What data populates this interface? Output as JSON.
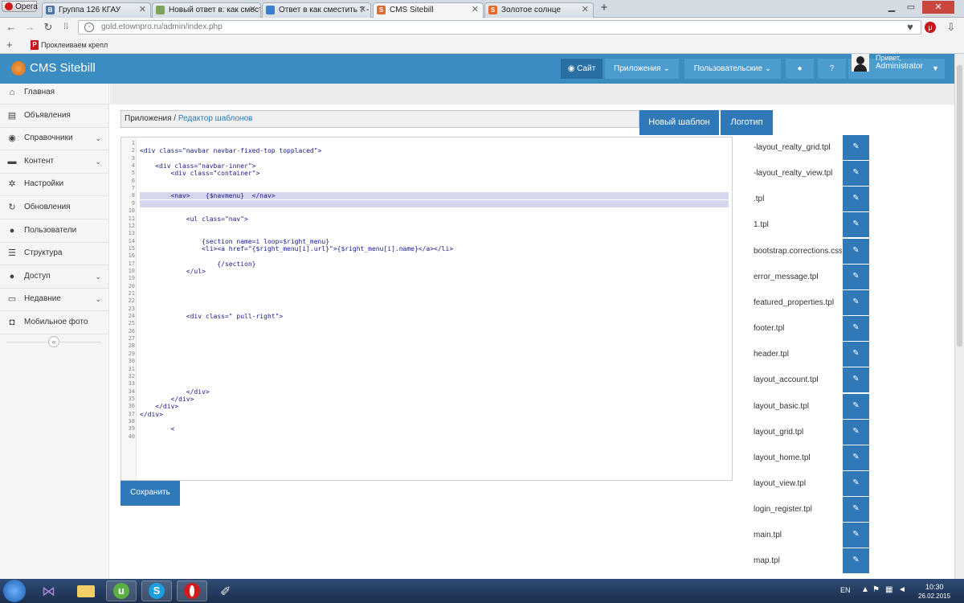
{
  "browser": {
    "menu_label": "Opera",
    "tabs": [
      {
        "title": "Группа 126 КГАУ",
        "fav": "B",
        "fav_color": "#4a76a8"
      },
      {
        "title": "Новый ответ в: как смест",
        "fav": "",
        "fav_color": "#7aa55a"
      },
      {
        "title": "Ответ в как сместить ? - ",
        "fav": "",
        "fav_color": "#3c7bd5"
      },
      {
        "title": "CMS Sitebill",
        "fav": "S",
        "fav_color": "#e26a2c"
      },
      {
        "title": "Золотое солнце",
        "fav": "S",
        "fav_color": "#e26a2c"
      }
    ],
    "url": "gold.etownpro.ru/admin/index.php",
    "bookmark": "Проклеиваем крепл"
  },
  "header": {
    "title": "CMS Sitebill",
    "site_button": "Сайт",
    "apps_button": "Приложения",
    "user_button": "Пользовательские",
    "greeting": "Привет,",
    "username": "Administrator"
  },
  "sidebar": {
    "items": [
      {
        "label": "Главная",
        "icon": "home-icon",
        "glyph": "⌂",
        "chevron": false
      },
      {
        "label": "Объявления",
        "icon": "list-icon",
        "glyph": "▤",
        "chevron": false
      },
      {
        "label": "Справочники",
        "icon": "globe-icon",
        "glyph": "◉",
        "chevron": true
      },
      {
        "label": "Контент",
        "icon": "monitor-icon",
        "glyph": "▬",
        "chevron": true
      },
      {
        "label": "Настройки",
        "icon": "gear-icon",
        "glyph": "✲",
        "chevron": false
      },
      {
        "label": "Обновления",
        "icon": "refresh-icon",
        "glyph": "↻",
        "chevron": false
      },
      {
        "label": "Пользователи",
        "icon": "user-icon",
        "glyph": "●",
        "chevron": false
      },
      {
        "label": "Структура",
        "icon": "structure-icon",
        "glyph": "☰",
        "chevron": false
      },
      {
        "label": "Доступ",
        "icon": "users-icon",
        "glyph": "●",
        "chevron": true
      },
      {
        "label": "Недавние",
        "icon": "desktop-icon",
        "glyph": "▭",
        "chevron": true
      },
      {
        "label": "Мобильное фото",
        "icon": "camera-icon",
        "glyph": "◘",
        "chevron": false
      }
    ]
  },
  "breadcrumb": {
    "root": "Приложения",
    "sep": " / ",
    "current": "Редактор шаблонов"
  },
  "buttons": {
    "new_template": "Новый шаблон",
    "logo": "Логотип",
    "save": "Сохранить"
  },
  "editor": {
    "lines": [
      "",
      "<div class=\"navbar navbar-fixed-top topplaced\">",
      "",
      "    <div class=\"navbar-inner\">",
      "        <div class=\"container\">",
      "",
      "",
      "        <nav>    {$navmenu}  </nav>",
      "",
      "",
      "            <ul class=\"nav\">",
      "",
      "",
      "                {section name=i loop=$right_menu}",
      "                <li><a href=\"{$right_menu[i].url}\">{$right_menu[i].name}</a></li>",
      "",
      "                    {/section}",
      "            </ul>",
      "",
      "",
      "",
      "",
      "",
      "            <div class=\" pull-right\">",
      "",
      "",
      "",
      "",
      "",
      "",
      "",
      "",
      "",
      "            </div>",
      "        </div>",
      "    </div>",
      "</div>",
      "",
      "        <",
      ""
    ],
    "highlight_lines": [
      7,
      8
    ]
  },
  "files": [
    "-layout_realty_grid.tpl",
    "-layout_realty_view.tpl",
    ".tpl",
    "1.tpl",
    "bootstrap.corrections.css",
    "error_message.tpl",
    "featured_properties.tpl",
    "footer.tpl",
    "header.tpl",
    "layout_account.tpl",
    "layout_basic.tpl",
    "layout_grid.tpl",
    "layout_home.tpl",
    "layout_view.tpl",
    "login_register.tpl",
    "main.tpl",
    "map.tpl"
  ],
  "taskbar": {
    "lang": "EN",
    "time": "10:30",
    "date": "26.02.2015"
  }
}
